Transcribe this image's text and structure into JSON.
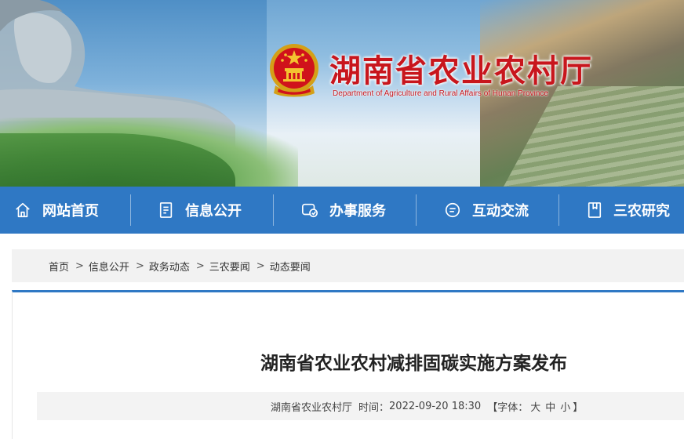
{
  "header": {
    "site_title": "湖南省农业农村厅",
    "site_subtitle": "Department of Agriculture and Rural Affairs of Hunan Province"
  },
  "nav": {
    "items": [
      {
        "label": "网站首页",
        "icon": "home-icon"
      },
      {
        "label": "信息公开",
        "icon": "document-icon"
      },
      {
        "label": "办事服务",
        "icon": "service-icon"
      },
      {
        "label": "互动交流",
        "icon": "chat-icon"
      },
      {
        "label": "三农研究",
        "icon": "book-icon"
      }
    ]
  },
  "breadcrumb": {
    "items": [
      "首页",
      "信息公开",
      "政务动态",
      "三农要闻",
      "动态要闻"
    ],
    "separator": ">"
  },
  "article": {
    "title": "湖南省农业农村减排固碳实施方案发布",
    "source": "湖南省农业农村厅",
    "time_label": "时间：",
    "time": "2022-09-20 18:30",
    "font_label": "【字体：",
    "font_large": "大",
    "font_medium": "中",
    "font_small": "小",
    "font_close": "】"
  },
  "colors": {
    "nav_bg": "#2f78c4",
    "title_red": "#c8161d"
  }
}
